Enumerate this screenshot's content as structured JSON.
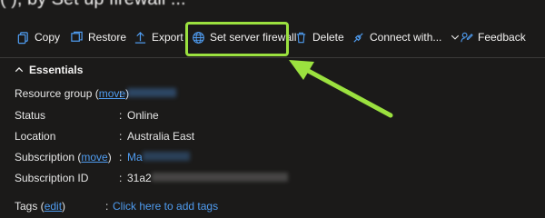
{
  "header": {
    "title": "(                 ), by Set up firewall ..."
  },
  "toolbar": {
    "copy": "Copy",
    "restore": "Restore",
    "export": "Export",
    "set_server_firewall": "Set server firewall",
    "delete": "Delete",
    "connect_with": "Connect with...",
    "feedback": "Feedback"
  },
  "essentials": {
    "heading": "Essentials",
    "resource_group_label": "Resource group (",
    "move_link": "move",
    "label_close": ")",
    "resource_group_value": "              ",
    "status_label": "Status",
    "status_value": "Online",
    "location_label": "Location",
    "location_value": "Australia East",
    "subscription_label": "Subscription (",
    "subscription_value_visible": "Ma",
    "subscription_value_hidden": "             ",
    "subscription_id_label": "Subscription ID",
    "subscription_id_visible": "31a2",
    "subscription_id_hidden": "                                        ",
    "tags_label": "Tags (",
    "edit_link": "edit",
    "tags_value": "Click here to add tags",
    "colon": ":"
  },
  "colors": {
    "highlight": "#9be13f",
    "link": "#4f9cf0",
    "background": "#1b1a19"
  }
}
